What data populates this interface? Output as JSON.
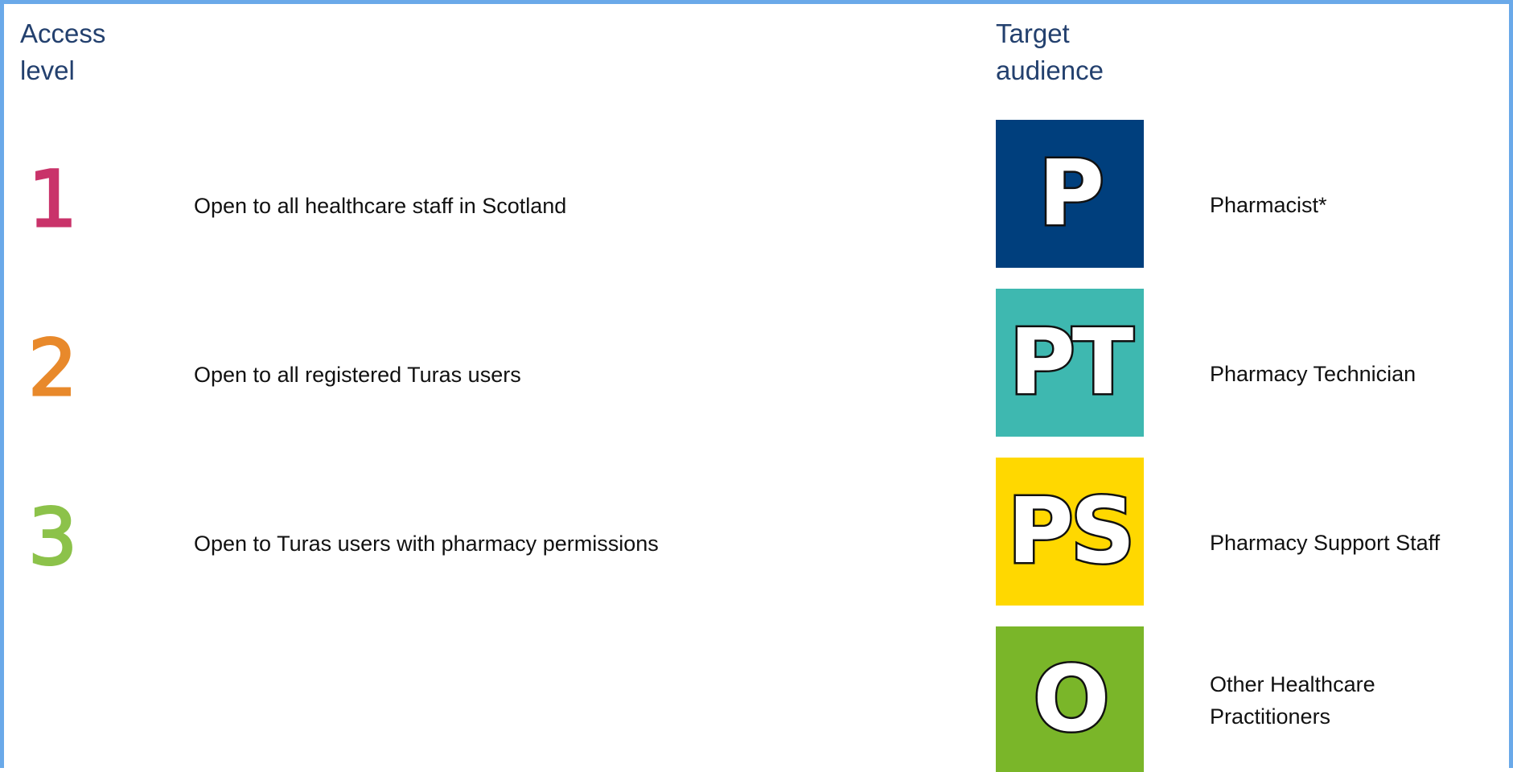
{
  "headings": {
    "access_level": "Access level",
    "target_audience": "Target audience"
  },
  "access_levels": [
    {
      "number": "1",
      "description": "Open to all healthcare staff in Scotland",
      "color": "#c9336a"
    },
    {
      "number": "2",
      "description": "Open to all registered Turas users",
      "color": "#e8892b"
    },
    {
      "number": "3",
      "description": "Open to Turas users with pharmacy permissions",
      "color": "#8cc24a"
    }
  ],
  "audiences": [
    {
      "code": "P",
      "label": "Pharmacist*",
      "color": "#003f7d"
    },
    {
      "code": "PT",
      "label": "Pharmacy Technician",
      "color": "#3eb8b0"
    },
    {
      "code": "PS",
      "label": "Pharmacy Support Staff",
      "color": "#ffd800"
    },
    {
      "code": "O",
      "label": "Other Healthcare Practitioners",
      "color": "#7ab629"
    }
  ],
  "colors": {
    "border": "#6aa9e9",
    "heading": "#23406e"
  }
}
